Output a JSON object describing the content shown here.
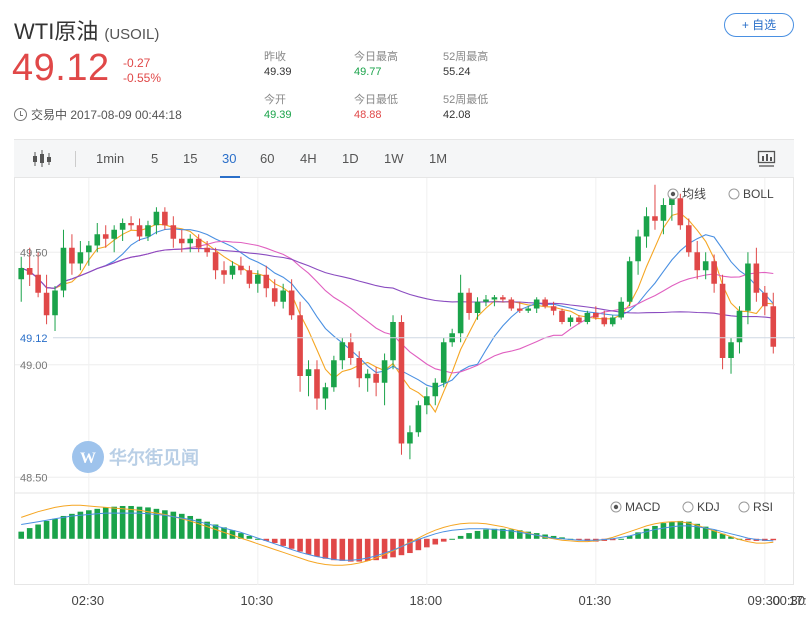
{
  "header": {
    "name": "WTI原油",
    "code": "(USOIL)",
    "add_button": "+ 自选",
    "price": "49.12",
    "change": "-0.27",
    "change_pct": "-0.55%",
    "status": "交易中 2017-08-09 00:44:18"
  },
  "stats": [
    {
      "label": "昨收",
      "value": "49.39"
    },
    {
      "label": "今日最高",
      "value": "49.77"
    },
    {
      "label": "52周最高",
      "value": "55.24"
    },
    {
      "label": "今开",
      "value": "49.39"
    },
    {
      "label": "今日最低",
      "value": "48.88"
    },
    {
      "label": "52周最低",
      "value": "42.08"
    }
  ],
  "toolbar": {
    "periods": [
      "1min",
      "5",
      "15",
      "30",
      "60",
      "4H",
      "1D",
      "1W",
      "1M"
    ],
    "active": "30"
  },
  "overlay_options": [
    {
      "label": "均线",
      "selected": true
    },
    {
      "label": "BOLL",
      "selected": false
    }
  ],
  "indicator_options": [
    {
      "label": "MACD",
      "selected": true
    },
    {
      "label": "KDJ",
      "selected": false
    },
    {
      "label": "RSI",
      "selected": false
    }
  ],
  "watermark": "华尔街见闻",
  "colors": {
    "up": "#e04848",
    "down": "#1aa34a",
    "ma5": "#f5a623",
    "ma10": "#4a90e2",
    "ma20": "#e060c0",
    "ma60": "#8a4cc0",
    "accent": "#2a6fc9"
  },
  "chart_data": {
    "type": "candlestick",
    "y_ticks": [
      "49.50",
      "49.00",
      "48.50"
    ],
    "y_tick_values": [
      49.5,
      49.0,
      48.5
    ],
    "ylim": [
      48.43,
      49.83
    ],
    "current_price": "49.12",
    "x_tick_labels": [
      "02:30",
      "10:30",
      "18:00",
      "01:30",
      "09:30",
      "17:00",
      "00:30"
    ],
    "x_tick_index": [
      8,
      28,
      48,
      68,
      88,
      108,
      128
    ],
    "candles": [
      [
        49.38,
        49.48,
        49.28,
        49.43
      ],
      [
        49.43,
        49.52,
        49.35,
        49.4
      ],
      [
        49.4,
        49.5,
        49.3,
        49.32
      ],
      [
        49.32,
        49.4,
        49.18,
        49.22
      ],
      [
        49.22,
        49.35,
        49.15,
        49.33
      ],
      [
        49.33,
        49.6,
        49.3,
        49.52
      ],
      [
        49.52,
        49.58,
        49.4,
        49.45
      ],
      [
        49.45,
        49.55,
        49.42,
        49.5
      ],
      [
        49.5,
        49.55,
        49.44,
        49.53
      ],
      [
        49.53,
        49.63,
        49.5,
        49.58
      ],
      [
        49.58,
        49.62,
        49.52,
        49.56
      ],
      [
        49.56,
        49.62,
        49.5,
        49.6
      ],
      [
        49.6,
        49.65,
        49.55,
        49.63
      ],
      [
        49.63,
        49.66,
        49.6,
        49.62
      ],
      [
        49.62,
        49.65,
        49.55,
        49.57
      ],
      [
        49.57,
        49.64,
        49.55,
        49.62
      ],
      [
        49.62,
        49.7,
        49.58,
        49.68
      ],
      [
        49.68,
        49.7,
        49.6,
        49.62
      ],
      [
        49.62,
        49.66,
        49.52,
        49.56
      ],
      [
        49.56,
        49.6,
        49.5,
        49.54
      ],
      [
        49.54,
        49.58,
        49.5,
        49.56
      ],
      [
        49.56,
        49.58,
        49.5,
        49.52
      ],
      [
        49.52,
        49.55,
        49.48,
        49.5
      ],
      [
        49.5,
        49.52,
        49.38,
        49.42
      ],
      [
        49.42,
        49.46,
        49.36,
        49.4
      ],
      [
        49.4,
        49.46,
        49.38,
        49.44
      ],
      [
        49.44,
        49.48,
        49.4,
        49.42
      ],
      [
        49.42,
        49.44,
        49.34,
        49.36
      ],
      [
        49.36,
        49.42,
        49.32,
        49.4
      ],
      [
        49.4,
        49.44,
        49.3,
        49.34
      ],
      [
        49.34,
        49.38,
        49.26,
        49.28
      ],
      [
        49.28,
        49.36,
        49.25,
        49.33
      ],
      [
        49.33,
        49.38,
        49.2,
        49.22
      ],
      [
        49.22,
        49.28,
        48.88,
        48.95
      ],
      [
        48.95,
        49.02,
        48.86,
        48.98
      ],
      [
        48.98,
        49.02,
        48.8,
        48.85
      ],
      [
        48.85,
        48.92,
        48.8,
        48.9
      ],
      [
        48.9,
        49.04,
        48.88,
        49.02
      ],
      [
        49.02,
        49.12,
        48.98,
        49.1
      ],
      [
        49.1,
        49.14,
        49.0,
        49.03
      ],
      [
        49.03,
        49.06,
        48.9,
        48.94
      ],
      [
        48.94,
        48.98,
        48.88,
        48.96
      ],
      [
        48.96,
        48.99,
        48.86,
        48.92
      ],
      [
        48.92,
        49.05,
        48.82,
        49.02
      ],
      [
        49.02,
        49.22,
        48.98,
        49.19
      ],
      [
        49.19,
        49.22,
        48.6,
        48.65
      ],
      [
        48.65,
        48.73,
        48.58,
        48.7
      ],
      [
        48.7,
        48.84,
        48.68,
        48.82
      ],
      [
        48.82,
        48.9,
        48.78,
        48.86
      ],
      [
        48.86,
        48.94,
        48.82,
        48.92
      ],
      [
        48.92,
        49.12,
        48.9,
        49.1
      ],
      [
        49.1,
        49.16,
        49.08,
        49.14
      ],
      [
        49.14,
        49.4,
        49.1,
        49.32
      ],
      [
        49.32,
        49.34,
        49.2,
        49.23
      ],
      [
        49.23,
        49.3,
        49.2,
        49.28
      ],
      [
        49.28,
        49.31,
        49.26,
        49.29
      ],
      [
        49.29,
        49.31,
        49.26,
        49.3
      ],
      [
        49.3,
        49.31,
        49.28,
        49.29
      ],
      [
        49.29,
        49.3,
        49.24,
        49.25
      ],
      [
        49.25,
        49.28,
        49.23,
        49.24
      ],
      [
        49.24,
        49.26,
        49.23,
        49.25
      ],
      [
        49.25,
        49.3,
        49.23,
        49.29
      ],
      [
        49.29,
        49.3,
        49.25,
        49.26
      ],
      [
        49.26,
        49.28,
        49.22,
        49.24
      ],
      [
        49.24,
        49.25,
        49.18,
        49.19
      ],
      [
        49.19,
        49.22,
        49.17,
        49.21
      ],
      [
        49.21,
        49.22,
        49.18,
        49.19
      ],
      [
        49.19,
        49.24,
        49.18,
        49.23
      ],
      [
        49.23,
        49.26,
        49.2,
        49.21
      ],
      [
        49.21,
        49.24,
        49.17,
        49.18
      ],
      [
        49.18,
        49.22,
        49.17,
        49.21
      ],
      [
        49.21,
        49.3,
        49.2,
        49.28
      ],
      [
        49.28,
        49.48,
        49.26,
        49.46
      ],
      [
        49.46,
        49.6,
        49.4,
        49.57
      ],
      [
        49.57,
        49.7,
        49.52,
        49.66
      ],
      [
        49.66,
        49.8,
        49.6,
        49.64
      ],
      [
        49.64,
        49.74,
        49.58,
        49.71
      ],
      [
        49.71,
        49.77,
        49.64,
        49.74
      ],
      [
        49.74,
        49.76,
        49.6,
        49.62
      ],
      [
        49.62,
        49.65,
        49.48,
        49.5
      ],
      [
        49.5,
        49.55,
        49.38,
        49.42
      ],
      [
        49.42,
        49.5,
        49.38,
        49.46
      ],
      [
        49.46,
        49.49,
        49.32,
        49.36
      ],
      [
        49.36,
        49.4,
        48.98,
        49.03
      ],
      [
        49.03,
        49.12,
        48.96,
        49.1
      ],
      [
        49.1,
        49.26,
        49.05,
        49.24
      ],
      [
        49.24,
        49.5,
        49.18,
        49.45
      ],
      [
        49.45,
        49.52,
        49.28,
        49.32
      ],
      [
        49.32,
        49.35,
        49.22,
        49.26
      ],
      [
        49.26,
        49.32,
        49.05,
        49.08
      ]
    ],
    "macd_hist": [
      0.01,
      0.015,
      0.02,
      0.025,
      0.028,
      0.032,
      0.035,
      0.038,
      0.04,
      0.042,
      0.044,
      0.045,
      0.046,
      0.046,
      0.045,
      0.044,
      0.042,
      0.04,
      0.038,
      0.035,
      0.032,
      0.028,
      0.024,
      0.02,
      0.016,
      0.012,
      0.008,
      0.004,
      0.0,
      -0.003,
      -0.006,
      -0.01,
      -0.014,
      -0.018,
      -0.022,
      -0.025,
      -0.028,
      -0.03,
      -0.031,
      -0.032,
      -0.032,
      -0.031,
      -0.03,
      -0.028,
      -0.026,
      -0.023,
      -0.02,
      -0.016,
      -0.012,
      -0.008,
      -0.004,
      0.0,
      0.004,
      0.008,
      0.011,
      0.013,
      0.014,
      0.014,
      0.013,
      0.012,
      0.01,
      0.008,
      0.006,
      0.004,
      0.002,
      0.0,
      -0.002,
      -0.003,
      -0.004,
      -0.003,
      -0.002,
      0.0,
      0.004,
      0.009,
      0.014,
      0.018,
      0.022,
      0.024,
      0.025,
      0.024,
      0.021,
      0.017,
      0.012,
      0.007,
      0.003,
      0.0,
      -0.002,
      -0.003,
      -0.003,
      -0.002
    ],
    "macd_dif": [
      0.03,
      0.034,
      0.038,
      0.041,
      0.044,
      0.046,
      0.047,
      0.047,
      0.046,
      0.045,
      0.044,
      0.043,
      0.042,
      0.041,
      0.04,
      0.038,
      0.036,
      0.034,
      0.031,
      0.028,
      0.025,
      0.021,
      0.017,
      0.013,
      0.009,
      0.005,
      0.001,
      -0.003,
      -0.007,
      -0.011,
      -0.015,
      -0.019,
      -0.023,
      -0.027,
      -0.031,
      -0.034,
      -0.036,
      -0.037,
      -0.037,
      -0.036,
      -0.034,
      -0.031,
      -0.027,
      -0.022,
      -0.017,
      -0.011,
      -0.005,
      0.001,
      0.007,
      0.012,
      0.016,
      0.019,
      0.021,
      0.022,
      0.022,
      0.021,
      0.019,
      0.017,
      0.014,
      0.011,
      0.008,
      0.005,
      0.002,
      0.0,
      -0.002,
      -0.003,
      -0.004,
      -0.004,
      -0.003,
      -0.001,
      0.002,
      0.006,
      0.01,
      0.014,
      0.018,
      0.021,
      0.023,
      0.024,
      0.024,
      0.022,
      0.019,
      0.015,
      0.011,
      0.007,
      0.003,
      -0.001,
      -0.004,
      -0.006,
      -0.006,
      -0.005
    ],
    "macd_dea": [
      0.02,
      0.022,
      0.024,
      0.026,
      0.028,
      0.03,
      0.032,
      0.033,
      0.034,
      0.035,
      0.036,
      0.036,
      0.036,
      0.036,
      0.036,
      0.035,
      0.034,
      0.033,
      0.031,
      0.029,
      0.027,
      0.024,
      0.021,
      0.018,
      0.015,
      0.012,
      0.009,
      0.005,
      0.001,
      -0.003,
      -0.007,
      -0.011,
      -0.015,
      -0.019,
      -0.022,
      -0.025,
      -0.027,
      -0.029,
      -0.03,
      -0.03,
      -0.029,
      -0.027,
      -0.024,
      -0.02,
      -0.016,
      -0.011,
      -0.006,
      -0.001,
      0.003,
      0.007,
      0.01,
      0.012,
      0.013,
      0.014,
      0.014,
      0.014,
      0.013,
      0.012,
      0.011,
      0.009,
      0.007,
      0.005,
      0.003,
      0.001,
      0.0,
      -0.001,
      -0.002,
      -0.002,
      -0.002,
      -0.001,
      0.0,
      0.002,
      0.004,
      0.007,
      0.01,
      0.013,
      0.015,
      0.017,
      0.018,
      0.018,
      0.017,
      0.015,
      0.013,
      0.01,
      0.007,
      0.004,
      0.001,
      -0.001,
      -0.002,
      -0.003
    ],
    "macd_ylim": [
      -0.055,
      0.06
    ]
  }
}
